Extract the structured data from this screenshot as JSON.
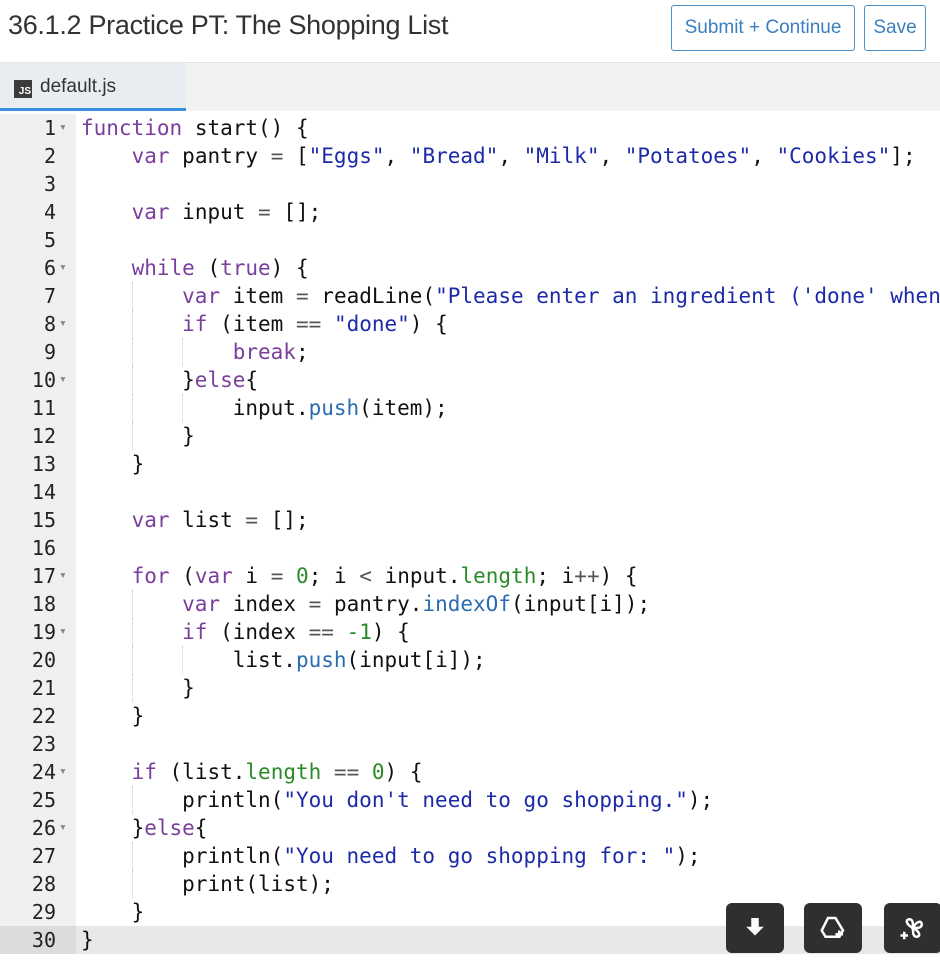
{
  "header": {
    "title": "36.1.2 Practice PT: The Shopping List",
    "submit_label": "Submit + Continue",
    "save_label": "Save"
  },
  "tabs": [
    {
      "icon": "js-file-icon",
      "icon_text": "JS",
      "label": "default.js"
    }
  ],
  "editor": {
    "active_line": 30,
    "lines": [
      {
        "n": "1",
        "fold": true
      },
      {
        "n": "2"
      },
      {
        "n": "3"
      },
      {
        "n": "4"
      },
      {
        "n": "5"
      },
      {
        "n": "6",
        "fold": true
      },
      {
        "n": "7"
      },
      {
        "n": "8",
        "fold": true
      },
      {
        "n": "9"
      },
      {
        "n": "10",
        "fold": true
      },
      {
        "n": "11"
      },
      {
        "n": "12"
      },
      {
        "n": "13"
      },
      {
        "n": "14"
      },
      {
        "n": "15"
      },
      {
        "n": "16"
      },
      {
        "n": "17",
        "fold": true
      },
      {
        "n": "18"
      },
      {
        "n": "19",
        "fold": true
      },
      {
        "n": "20"
      },
      {
        "n": "21"
      },
      {
        "n": "22"
      },
      {
        "n": "23"
      },
      {
        "n": "24",
        "fold": true
      },
      {
        "n": "25"
      },
      {
        "n": "26",
        "fold": true
      },
      {
        "n": "27"
      },
      {
        "n": "28"
      },
      {
        "n": "29"
      },
      {
        "n": "30"
      }
    ],
    "code": [
      "function start() {",
      "    var pantry = [\"Eggs\", \"Bread\", \"Milk\", \"Potatoes\", \"Cookies\"];",
      "",
      "    var input = [];",
      "",
      "    while (true) {",
      "        var item = readLine(\"Please enter an ingredient ('done' when",
      "        if (item == \"done\") {",
      "            break;",
      "        }else{",
      "            input.push(item);",
      "        }",
      "    }",
      "",
      "    var list = [];",
      "",
      "    for (var i = 0; i < input.length; i++) {",
      "        var index = pantry.indexOf(input[i]);",
      "        if (index == -1) {",
      "            list.push(input[i]);",
      "        }",
      "    }",
      "",
      "    if (list.length == 0) {",
      "        println(\"You don't need to go shopping.\");",
      "    }else{",
      "        println(\"You need to go shopping for: \");",
      "        print(list);",
      "    }",
      "}"
    ]
  },
  "floating_buttons": [
    {
      "name": "download-icon"
    },
    {
      "name": "add-to-drive-icon"
    },
    {
      "name": "add-to-photos-icon"
    }
  ],
  "colors": {
    "keyword": "#7a3e9d",
    "string": "#1c2aa8",
    "number": "#2a8a2a",
    "method": "#2b6cb0",
    "button_accent": "#3a7fc0",
    "tab_underline": "#3a8fd8"
  }
}
